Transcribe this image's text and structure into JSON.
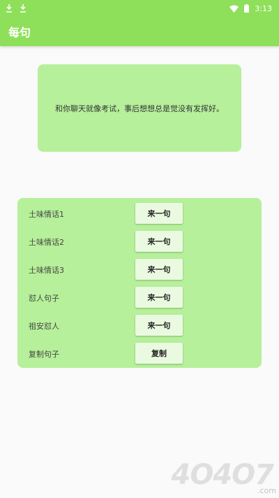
{
  "status_bar": {
    "time": "3:13",
    "left_icons": [
      "download-icon",
      "download-icon"
    ],
    "right_icons": [
      "wifi-icon",
      "battery-icon"
    ]
  },
  "app_bar": {
    "title": "每句",
    "color": "#8ee05a"
  },
  "quote": {
    "text": "和你聊天就像考试，事后想想总是觉没有发挥好。",
    "background": "#b6f09a"
  },
  "actions": [
    {
      "label": "土味情话1",
      "button": "来一句"
    },
    {
      "label": "土味情话2",
      "button": "来一句"
    },
    {
      "label": "土味情话3",
      "button": "来一句"
    },
    {
      "label": "怼人句子",
      "button": "来一句"
    },
    {
      "label": "祖安怼人",
      "button": "来一句"
    },
    {
      "label": "复制句子",
      "button": "复制"
    }
  ],
  "watermark": {
    "text": "4O4O7",
    "suffix": ".com"
  }
}
